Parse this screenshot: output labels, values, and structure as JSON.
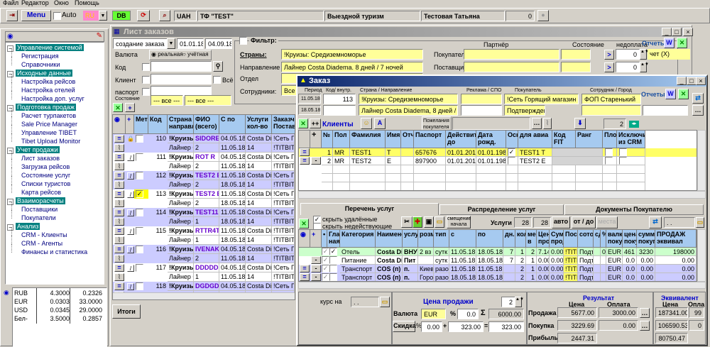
{
  "menu": [
    "Файл",
    "Редактор",
    "Окно",
    "Помощь"
  ],
  "toolbar": {
    "menu_label": "Menu",
    "auto_label": "Auto",
    "lang": "RU",
    "db": "DB",
    "currency": "UAH",
    "company": "ТФ \"TEST\"",
    "department": "Выездной туризм",
    "user": "Тестовая Татьяна",
    "counter": "0"
  },
  "sidebar": {
    "groups": [
      {
        "label": "Управление системой",
        "items": [
          "Регистрация",
          "Справочники"
        ]
      },
      {
        "label": "Исходные данные",
        "items": [
          "Настройка рейсов",
          "Настройка отелей",
          "Настройка доп. услуг"
        ]
      },
      {
        "label": "Подготовка продаж",
        "items": [
          "Расчет турпакетов",
          "Sale Price Manager",
          "Управление TIBET",
          "Tibet Upload Monitor"
        ]
      },
      {
        "label": "Учет продажи",
        "items": [
          "Лист заказов",
          "Загрузка рейсов",
          "Состояние услуг",
          "Списки туристов",
          "Карта рейсов"
        ]
      },
      {
        "label": "Взаиморасчеты",
        "items": [
          "Поставщики",
          "Покупатели"
        ]
      },
      {
        "label": "Анализ",
        "items": [
          "CRM - Клиенты",
          "CRM - Агенты",
          "Финансы и статистика"
        ]
      }
    ],
    "rates": [
      [
        "RUB",
        "4.3000",
        "0.2326"
      ],
      [
        "EUR",
        "0.0303",
        "33.0000"
      ],
      [
        "USD",
        "0.0345",
        "29.0000"
      ],
      [
        "Бел-",
        "3.5000",
        "0.2857"
      ]
    ]
  },
  "orders_window": {
    "title": "Лист заказов",
    "mode": "создание заказа",
    "date_from": "01.01.18",
    "date_to": "04.09.18",
    "currency_label": "Валюта",
    "radio_real": "реальная",
    "radio_account": "учётная",
    "code_label": "Код",
    "client_label": "Клиент",
    "all_label": "Всё",
    "passport_label": "паспорт",
    "state_label": "Состояние",
    "state1": "--- все ---",
    "state2": "--- все ---",
    "filter_label": "Фильтр:",
    "countries_label": "Страны:",
    "countries_value": "!Круизы: Средиземноморье",
    "direction_label": "Направление",
    "direction_value": "Лайнер Costa Diadema. 8 дней / 7 ночей",
    "dept_label": "Отдел",
    "staff_label": "Сотрудники:",
    "staff_value": "Все",
    "partner_label": "Партнёр",
    "status_label": "Состояние",
    "unpaid_label": "недоплата",
    "buyers_label": "Покупатели:",
    "supplier_label": "Поставщик",
    "buyers_unpaid": "0",
    "supplier_unpaid": "0",
    "reports_label": "Отчеты",
    "account_value": "чет (X)",
    "totals_button": "Итоги",
    "columns": [
      "Мет",
      "Код",
      "Страна направл",
      "ФИО (всего)",
      "С по",
      "Услуги кол-во",
      "Заказч Постав"
    ],
    "rows": [
      {
        "code": "110",
        "country": "!Круизы",
        "dir": "Лайнер С",
        "fio": "SIDOREN",
        "count": "2",
        "from": "04.05.18",
        "to": "11.05.18",
        "svc": "Costa Dia",
        "qty": "14",
        "cust": "!Сеть Г",
        "sup": "!TITBIT",
        "locked": true,
        "checked": false
      },
      {
        "code": "111",
        "country": "!Круизы",
        "dir": "Лайнер С",
        "fio": "ROT R",
        "count": "2",
        "from": "04.05.18",
        "to": "11.05.18",
        "svc": "Costa Dia",
        "qty": "14",
        "cust": "!Сеть Г",
        "sup": "!TITBIT",
        "checked": false
      },
      {
        "code": "112",
        "country": "!Круизы",
        "dir": "Лайнер С",
        "fio": "TEST2 E",
        "count": "2",
        "from": "11.05.18",
        "to": "18.05.18",
        "svc": "Costa Dia",
        "qty": "14",
        "cust": "!Сеть Г",
        "sup": "!TITBIT",
        "checked": false
      },
      {
        "code": "113",
        "country": "!Круизы",
        "dir": "Лайнер С",
        "fio": "TEST2 E",
        "count": "2",
        "from": "11.05.18",
        "to": "18.05.18",
        "svc": "Costa Dia",
        "qty": "14",
        "cust": "!Сеть Г",
        "sup": "!TITBIT",
        "checked": true
      },
      {
        "code": "114",
        "country": "!Круизы",
        "dir": "Лайнер С",
        "fio": "TEST11",
        "count": "1",
        "from": "11.05.18",
        "to": "18.05.18",
        "svc": "Costa Dia",
        "qty": "14",
        "cust": "!Сеть Г",
        "sup": "!TITBIT",
        "checked": false
      },
      {
        "code": "115",
        "country": "!Круизы",
        "dir": "Лайнер С",
        "fio": "RTTR4T",
        "count": "1",
        "from": "11.05.18",
        "to": "18.05.18",
        "svc": "Costa Dia",
        "qty": "14",
        "cust": "!TITBIT",
        "sup": "!TITBIT",
        "checked": false
      },
      {
        "code": "116",
        "country": "!Круизы",
        "dir": "Лайнер С",
        "fio": "IVENAKO",
        "count": "2",
        "from": "04.05.18",
        "to": "11.05.18",
        "svc": "Costa Dia",
        "qty": "14",
        "cust": "!Сеть Г",
        "sup": "!TITBIT",
        "checked": false
      },
      {
        "code": "117",
        "country": "!Круизы",
        "dir": "Лайнер С",
        "fio": "DDDDDD",
        "count": "1",
        "from": "04.05.18",
        "to": "11.05.18",
        "svc": "Costa Dia",
        "qty": "14",
        "cust": "!Сеть Г",
        "sup": "!TITBIT",
        "checked": false
      },
      {
        "code": "118",
        "country": "!Круизы",
        "dir": "Лайнер С",
        "fio": "DGDGDG",
        "count": "1",
        "from": "04.05.18",
        "to": "11.05.18",
        "svc": "Costa Dia",
        "qty": "15",
        "cust": "!Сеть Г",
        "sup": "!TITBIT",
        "checked": false
      }
    ]
  },
  "order": {
    "title": "Заказ",
    "period_label": "Период",
    "period_from": "11.05.18",
    "period_to": "18.05.18",
    "code_label": "Код/ внутр.",
    "code": "113",
    "country_label": "Страна / Направление",
    "country": "!Круизы: Средиземноморье",
    "direction": "Лайнер Costa Diadema, 8 дней / 7 нс",
    "promo_label": "Реклама / СПО",
    "buyer_label": "Покупатель",
    "buyer": "!Сеть Горящий магазин",
    "status": "Подтвержден",
    "staff_label": "Сотрудник / Город",
    "staff": "ФОП Старенький",
    "reports_label": "Отчеты",
    "clients_label": "Клиенты",
    "wishes_label": "Пожелания покупателя",
    "client_count": "2",
    "client_columns": [
      "№",
      "Пол",
      "Фамилия",
      "Имя",
      "Отче",
      "Паспорт",
      "Действите до",
      "Дата рожд.",
      "Осн",
      "для авиа",
      "Код FIT",
      "Ранг",
      "Плох",
      "Исключит из CRM"
    ],
    "clients": [
      {
        "n": "1",
        "sex": "MR",
        "last": "TEST1",
        "first": "T",
        "passport": "657676",
        "valid": "01.01.2018",
        "birth": "01.01.1988",
        "main": true,
        "avia": "TEST1 T"
      },
      {
        "n": "2",
        "sex": "MR",
        "last": "TEST2",
        "first": "E",
        "passport": "897900",
        "valid": "01.01.2018",
        "birth": "01.01.1988",
        "main": false,
        "avia": "TEST2 E"
      }
    ],
    "tabs": [
      "Перечень услуг",
      "Распределение услуг",
      "Документы Покупателю"
    ],
    "hide_deleted": "скрыть удалённые",
    "hide_inactive": "скрыть недействующие",
    "shift_start": "смещение начала",
    "services_label": "Услуги",
    "services_count1": "28",
    "services_count2": "28",
    "auto_button": "авто",
    "fromto_button": "от / до",
    "places_button": "места",
    "date_placeholder": ". .",
    "service_columns": [
      "Глав ная",
      "Категория",
      "Наимено",
      "услу",
      "розм",
      "тип",
      "с",
      "по",
      "дн.",
      "кол",
      "мес в",
      "Цена прод",
      "Сумм прод",
      "Пост",
      "сото",
      "сд",
      "%",
      "валк поку",
      "цена поку",
      "сумма покуп",
      "ПРОДАЖ эквивал"
    ],
    "services": [
      [
        "Отель",
        "Costa Di",
        "ВНУТ",
        "2 вз",
        "сутк",
        "11.05.18",
        "18.05.18",
        "7",
        "1",
        "2",
        "7.14",
        "0.00",
        "!TITB",
        "Подт",
        "",
        "0",
        "EUR",
        "461",
        "3230",
        "198000"
      ],
      [
        "Питание",
        "Costa Di",
        "Пит",
        "",
        "сутк",
        "11.05.18",
        "18.05.18",
        "7",
        "2",
        "1",
        "0.00",
        "0.00",
        "!TITB",
        "Подт",
        "",
        "",
        "EUR",
        "0.0",
        "0.00",
        "0.00"
      ],
      [
        "Транспорт",
        "COS (п)",
        "п.",
        "Киев",
        "разов",
        "11.05.18",
        "11.05.18",
        "",
        "2",
        "1",
        "0.00",
        "0.00",
        "!TITB",
        "Подт",
        "",
        "",
        "EUR",
        "0.0",
        "0.00",
        "0.00"
      ],
      [
        "Транспорт",
        "COS (п)",
        "п.",
        "Горо",
        "разов",
        "18.05.18",
        "18.05.18",
        "",
        "2",
        "1",
        "0.00",
        "0.00",
        "!TITB",
        "Подт",
        "",
        "",
        "EUR",
        "0.0",
        "0.00",
        "0.00"
      ]
    ],
    "rate_on_label": "курс на",
    "rate_date": ". .",
    "sale_price_label": "Цена продажи",
    "precision": "2",
    "currency_label": "Валюта",
    "currency": "EUR",
    "percent": "0.0",
    "sum": "6000.00",
    "discount_button": "Скидка",
    "discount_pct": "0.00",
    "add": "323.00",
    "total": "323.00",
    "result_label": "Результат",
    "price_label": "Цена",
    "payment_label": "Оплата",
    "sale_label": "Продажа",
    "purchase_label": "Покупка",
    "profit_label": "Прибыль",
    "sale_price": "5677.00",
    "sale_paid": "3000.00",
    "purchase_price": "3229.69",
    "purchase_paid": "0.00",
    "profit": "2447.31",
    "equiv_label": "Эквивалент",
    "equiv_price_label": "Цена",
    "equiv_paid_label": "Опла",
    "equiv_sale": "187341.00",
    "equiv_sale_paid": "99",
    "equiv_purchase": "106590.53",
    "equiv_purchase_paid": "0",
    "equiv_profit": "80750.47"
  },
  "colors": {
    "accent": "#0a246a",
    "header": "#a6caf0",
    "highlight": "#ffff99",
    "tree": "#008080",
    "row_alt": "#ccccff"
  }
}
